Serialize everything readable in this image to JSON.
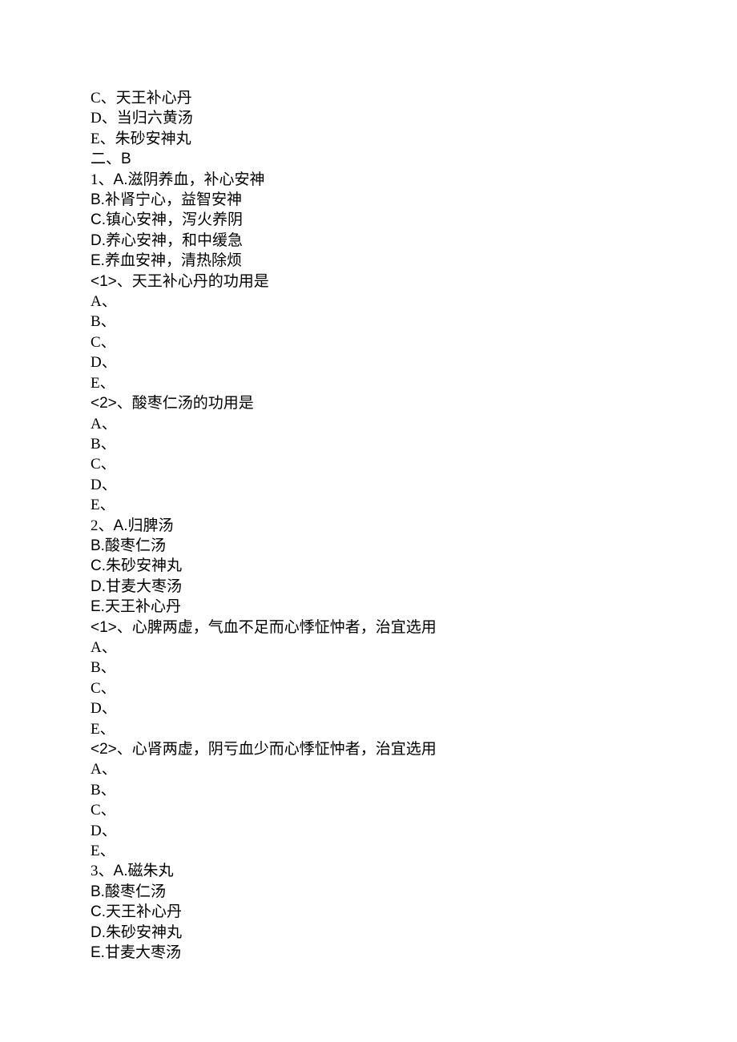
{
  "lines": [
    [
      {
        "t": "C、天王补心丹",
        "latin": false
      }
    ],
    [
      {
        "t": "D、当归六黄汤",
        "latin": false
      }
    ],
    [
      {
        "t": "E、朱砂安神丸",
        "latin": false
      }
    ],
    [
      {
        "t": "二、",
        "latin": false
      },
      {
        "t": "B",
        "latin": true
      }
    ],
    [
      {
        "t": "1、",
        "latin": false
      },
      {
        "t": "A.",
        "latin": true
      },
      {
        "t": "滋阴养血，补心安神",
        "latin": false
      }
    ],
    [
      {
        "t": "B.",
        "latin": true
      },
      {
        "t": "补肾宁心，益智安神",
        "latin": false
      }
    ],
    [
      {
        "t": "C.",
        "latin": true
      },
      {
        "t": "镇心安神，泻火养阴",
        "latin": false
      }
    ],
    [
      {
        "t": "D.",
        "latin": true
      },
      {
        "t": "养心安神，和中缓急",
        "latin": false
      }
    ],
    [
      {
        "t": "E.",
        "latin": true
      },
      {
        "t": "养血安神，清热除烦",
        "latin": false
      }
    ],
    [
      {
        "t": "<1>",
        "latin": true
      },
      {
        "t": "、天王补心丹的功用是",
        "latin": false
      }
    ],
    [
      {
        "t": "A、",
        "latin": false
      }
    ],
    [
      {
        "t": "B、",
        "latin": false
      }
    ],
    [
      {
        "t": "C、",
        "latin": false
      }
    ],
    [
      {
        "t": "D、",
        "latin": false
      }
    ],
    [
      {
        "t": "E、",
        "latin": false
      }
    ],
    [
      {
        "t": "<2>",
        "latin": true
      },
      {
        "t": "、酸枣仁汤的功用是",
        "latin": false
      }
    ],
    [
      {
        "t": "A、",
        "latin": false
      }
    ],
    [
      {
        "t": "B、",
        "latin": false
      }
    ],
    [
      {
        "t": "C、",
        "latin": false
      }
    ],
    [
      {
        "t": "D、",
        "latin": false
      }
    ],
    [
      {
        "t": "E、",
        "latin": false
      }
    ],
    [
      {
        "t": "2、",
        "latin": false
      },
      {
        "t": "A.",
        "latin": true
      },
      {
        "t": "归脾汤",
        "latin": false
      }
    ],
    [
      {
        "t": "B.",
        "latin": true
      },
      {
        "t": "酸枣仁汤",
        "latin": false
      }
    ],
    [
      {
        "t": "C.",
        "latin": true
      },
      {
        "t": "朱砂安神丸",
        "latin": false
      }
    ],
    [
      {
        "t": "D.",
        "latin": true
      },
      {
        "t": "甘麦大枣汤",
        "latin": false
      }
    ],
    [
      {
        "t": "E.",
        "latin": true
      },
      {
        "t": "天王补心丹",
        "latin": false
      }
    ],
    [
      {
        "t": "<1>",
        "latin": true
      },
      {
        "t": "、心脾两虚，气血不足而心悸怔忡者，治宜选用",
        "latin": false
      }
    ],
    [
      {
        "t": "A、",
        "latin": false
      }
    ],
    [
      {
        "t": "B、",
        "latin": false
      }
    ],
    [
      {
        "t": "C、",
        "latin": false
      }
    ],
    [
      {
        "t": "D、",
        "latin": false
      }
    ],
    [
      {
        "t": "E、",
        "latin": false
      }
    ],
    [
      {
        "t": "<2>",
        "latin": true
      },
      {
        "t": "、心肾两虚，阴亏血少而心悸怔忡者，治宜选用",
        "latin": false
      }
    ],
    [
      {
        "t": "A、",
        "latin": false
      }
    ],
    [
      {
        "t": "B、",
        "latin": false
      }
    ],
    [
      {
        "t": "C、",
        "latin": false
      }
    ],
    [
      {
        "t": "D、",
        "latin": false
      }
    ],
    [
      {
        "t": "E、",
        "latin": false
      }
    ],
    [
      {
        "t": "3、",
        "latin": false
      },
      {
        "t": "A.",
        "latin": true
      },
      {
        "t": "磁朱丸",
        "latin": false
      }
    ],
    [
      {
        "t": "B.",
        "latin": true
      },
      {
        "t": "酸枣仁汤",
        "latin": false
      }
    ],
    [
      {
        "t": "C.",
        "latin": true
      },
      {
        "t": "天王补心丹",
        "latin": false
      }
    ],
    [
      {
        "t": "D.",
        "latin": true
      },
      {
        "t": "朱砂安神丸",
        "latin": false
      }
    ],
    [
      {
        "t": "E.",
        "latin": true
      },
      {
        "t": "甘麦大枣汤",
        "latin": false
      }
    ]
  ]
}
